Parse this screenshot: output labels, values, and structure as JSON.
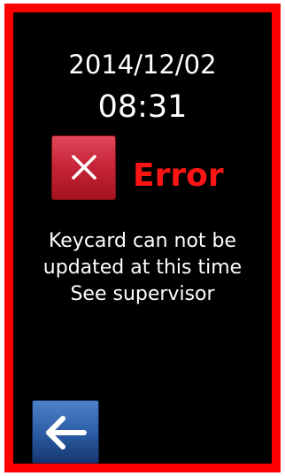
{
  "header": {
    "date": "2014/12/02",
    "time": "08:31"
  },
  "status": {
    "icon": "close-icon",
    "label": "Error",
    "color": "#ff1414"
  },
  "message": {
    "lines": [
      "Keycard can not be",
      "updated at this time",
      "See supervisor"
    ]
  },
  "navigation": {
    "back_icon": "arrow-left-icon"
  },
  "colors": {
    "frame": "#ff0000",
    "screen": "#000000",
    "error_icon_bg": "#c8263a",
    "back_button_bg": "#2d5fa8"
  }
}
